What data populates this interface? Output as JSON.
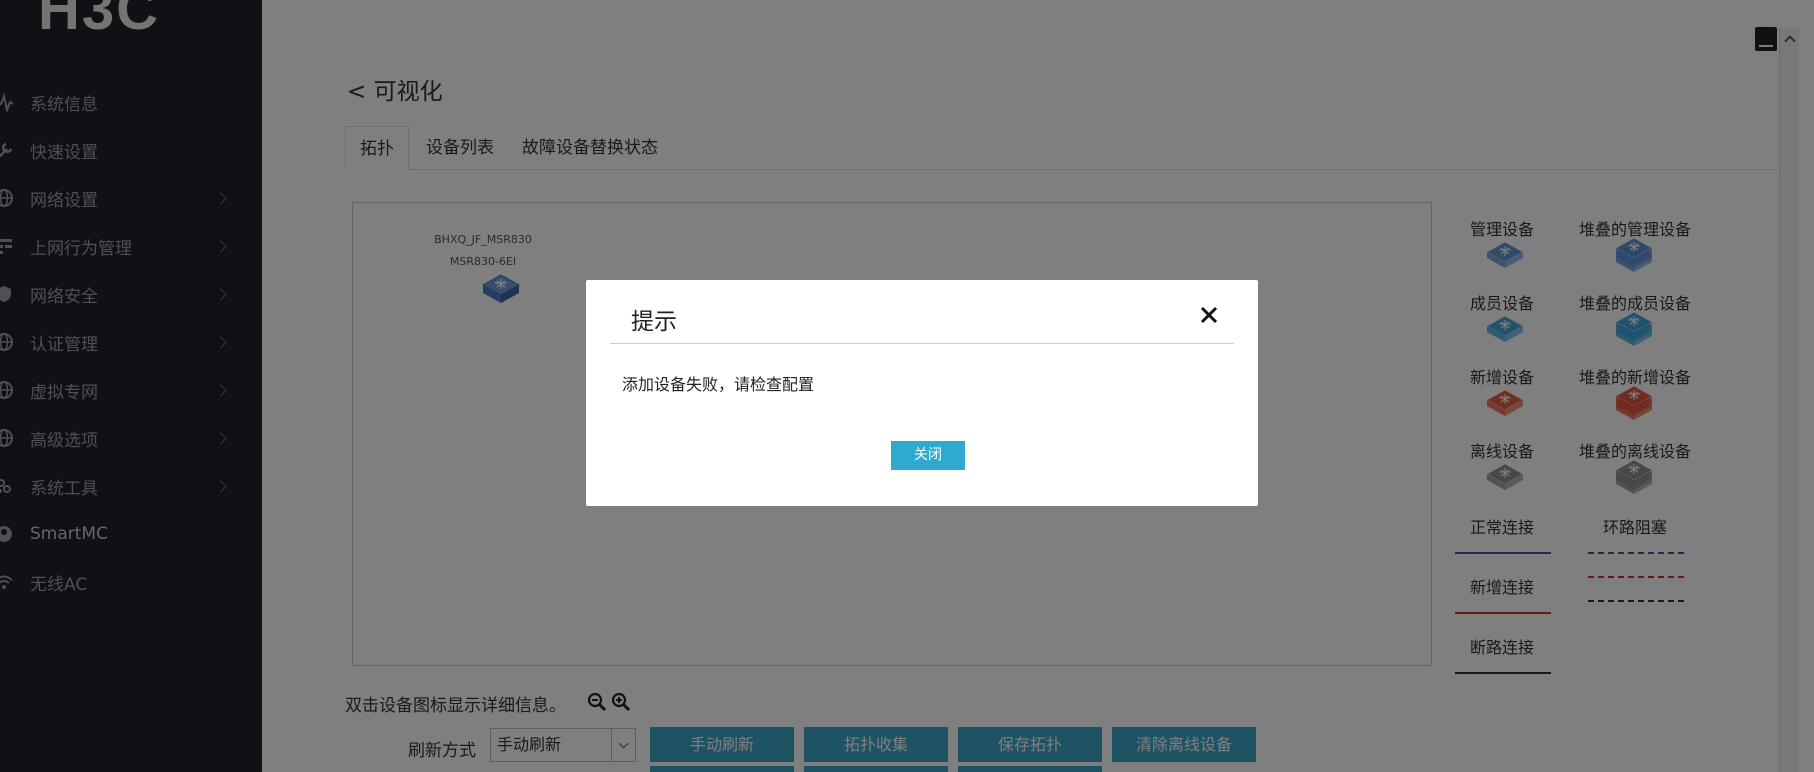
{
  "app": {
    "logo_text": "H3C"
  },
  "sidebar": {
    "items": [
      {
        "label": "系统信息",
        "icon": "pulse-icon",
        "has_submenu": false
      },
      {
        "label": "快速设置",
        "icon": "wrench-icon",
        "has_submenu": false
      },
      {
        "label": "网络设置",
        "icon": "globe-icon",
        "has_submenu": true
      },
      {
        "label": "上网行为管理",
        "icon": "grid-icon",
        "has_submenu": true
      },
      {
        "label": "网络安全",
        "icon": "shield-icon",
        "has_submenu": true
      },
      {
        "label": "认证管理",
        "icon": "globe-icon",
        "has_submenu": true
      },
      {
        "label": "虚拟专网",
        "icon": "globe-icon",
        "has_submenu": true
      },
      {
        "label": "高级选项",
        "icon": "globe-icon",
        "has_submenu": true
      },
      {
        "label": "系统工具",
        "icon": "tools-icon",
        "has_submenu": true
      },
      {
        "label": "SmartMC",
        "icon": "person-icon",
        "has_submenu": false
      },
      {
        "label": "无线AC",
        "icon": "wifi-icon",
        "has_submenu": false
      }
    ]
  },
  "header": {
    "back_title": "< 可视化"
  },
  "tabs": [
    {
      "label": "拓扑",
      "active": true
    },
    {
      "label": "设备列表",
      "active": false
    },
    {
      "label": "故障设备替换状态",
      "active": false
    }
  ],
  "topology": {
    "device": {
      "name": "BHXQ_JF_MSR830",
      "model": "MSR830-6EI"
    }
  },
  "legend": {
    "devices": [
      {
        "label": "管理设备",
        "color": "#5b8fd6"
      },
      {
        "label": "堆叠的管理设备",
        "color": "#5b8fd6"
      },
      {
        "label": "成员设备",
        "color": "#3aa3d8"
      },
      {
        "label": "堆叠的成员设备",
        "color": "#3aa3d8"
      },
      {
        "label": "新增设备",
        "color": "#e0553a"
      },
      {
        "label": "堆叠的新增设备",
        "color": "#e0553a"
      },
      {
        "label": "离线设备",
        "color": "#8c8c8c"
      },
      {
        "label": "堆叠的离线设备",
        "color": "#8c8c8c"
      }
    ],
    "links": {
      "normal": {
        "label": "正常连接",
        "color": "#3a5fa0"
      },
      "loop": {
        "label": "环路阻塞"
      },
      "new": {
        "label": "新增连接",
        "color": "#d0302a"
      },
      "broken": {
        "label": "断路连接",
        "color": "#333333"
      }
    }
  },
  "footer": {
    "hint": "双击设备图标显示详细信息。",
    "refresh_label": "刷新方式",
    "refresh_value": "手动刷新",
    "buttons": [
      "手动刷新",
      "拓扑收集",
      "保存拓扑",
      "清除离线设备"
    ]
  },
  "dialog": {
    "title": "提示",
    "message": "添加设备失败，请检查配置",
    "close_button": "关闭"
  }
}
